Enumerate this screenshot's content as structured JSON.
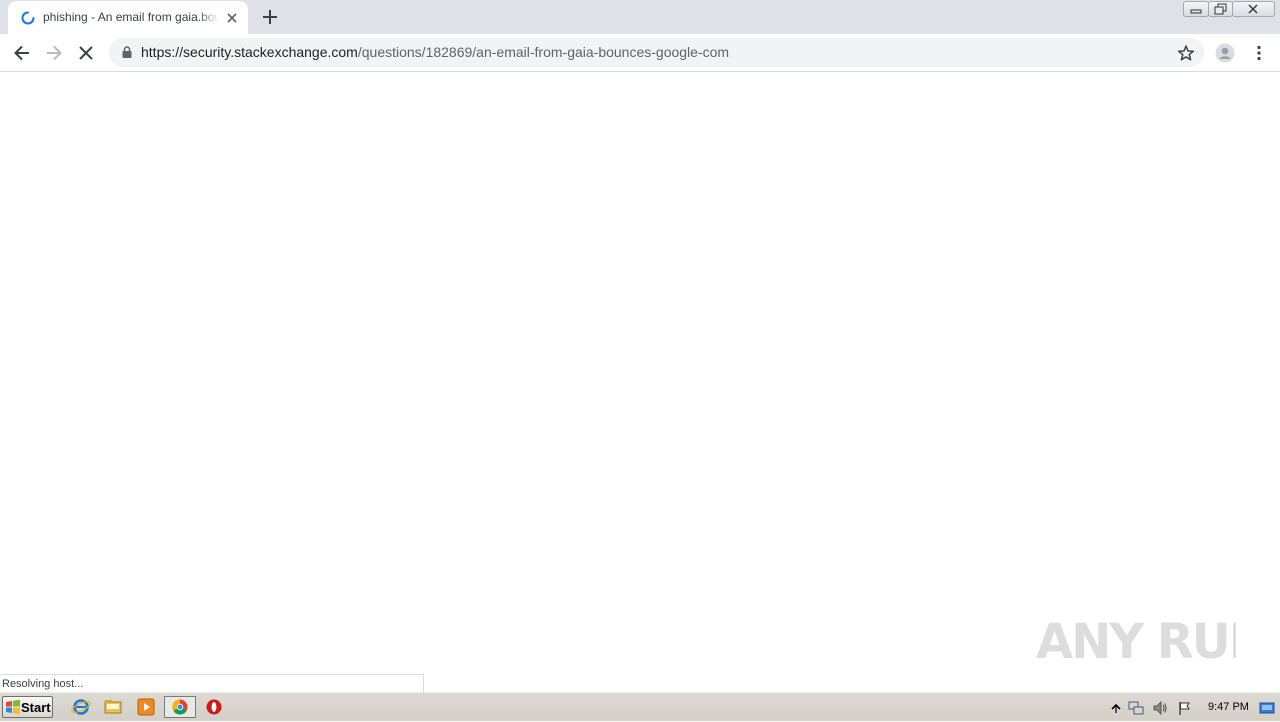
{
  "browser": {
    "tab": {
      "title": "phishing - An email from gaia.bounces-google-com"
    },
    "address": {
      "scheme": "https://",
      "host": "security.stackexchange.com",
      "path": "/questions/182869/an-email-from-gaia-bounces-google-com"
    },
    "status_text": "Resolving host...",
    "accent_color": "#1a73e8"
  },
  "watermark": {
    "text": "ANY RUN"
  },
  "taskbar": {
    "start_label": "Start",
    "clock": "9:47 PM",
    "apps": [
      "internet-explorer-icon",
      "file-explorer-icon",
      "media-player-icon",
      "chrome-icon",
      "opera-icon"
    ]
  }
}
